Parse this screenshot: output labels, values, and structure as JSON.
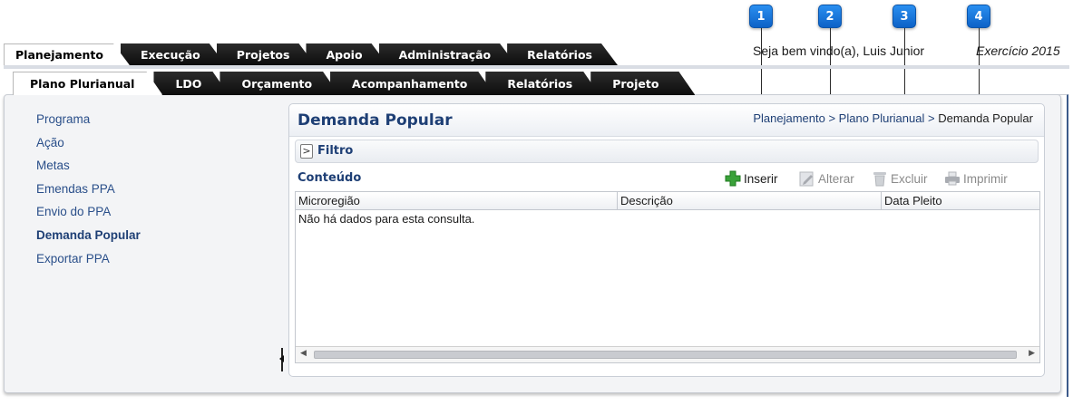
{
  "callouts": [
    "1",
    "2",
    "3",
    "4"
  ],
  "top_nav": [
    "Planejamento",
    "Execução",
    "Projetos",
    "Apoio",
    "Administração",
    "Relatórios"
  ],
  "sub_nav": [
    "Plano Plurianual",
    "LDO",
    "Orçamento",
    "Acompanhamento",
    "Relatórios",
    "Projeto"
  ],
  "header": {
    "welcome": "Seja bem vindo(a), Luis Junior",
    "exercicio": "Exercício 2015"
  },
  "side_menu": [
    "Programa",
    "Ação",
    "Metas",
    "Emendas PPA",
    "Envio do PPA",
    "Demanda Popular",
    "Exportar PPA"
  ],
  "panel": {
    "title": "Demanda Popular",
    "breadcrumb": {
      "part1": "Planejamento",
      "sep": ">",
      "part2": "Plano Plurianual",
      "part3": "Demanda Popular"
    },
    "filter_toggle": ">",
    "filter_label": "Filtro",
    "content_label": "Conteúdo"
  },
  "actions": {
    "insert": "Inserir",
    "edit": "Alterar",
    "delete": "Excluir",
    "print": "Imprimir"
  },
  "grid": {
    "columns": [
      "Microregião",
      "Descrição",
      "Data Pleito"
    ],
    "empty_message": "Não há dados para esta consulta."
  },
  "colors": {
    "nav_dark": "#111111",
    "link_blue": "#2a4f8a",
    "callout_blue": "#1a78e0",
    "insert_green": "#3aa23a"
  },
  "icons": {
    "insert": "plus-icon",
    "edit": "edit-icon",
    "delete": "trash-icon",
    "print": "printer-icon"
  }
}
